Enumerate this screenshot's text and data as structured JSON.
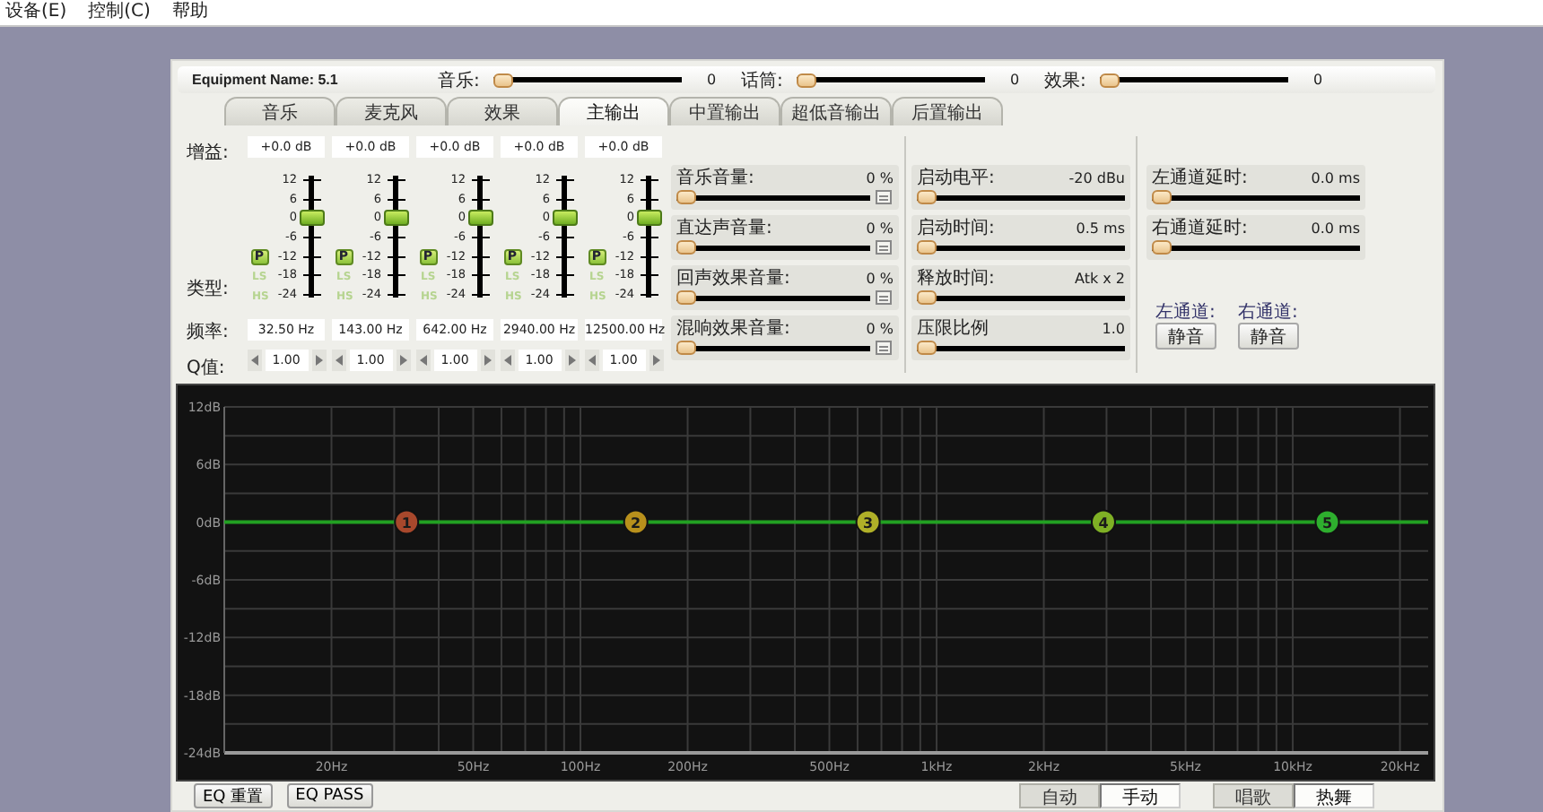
{
  "menu": [
    {
      "label": "设备(E)"
    },
    {
      "label": "控制(C)"
    },
    {
      "label": "帮助"
    }
  ],
  "equipment_name": "Equipment Name: 5.1",
  "top_sliders": [
    {
      "label": "音乐:",
      "level": 0,
      "reading": "0"
    },
    {
      "label": "话筒:",
      "level": 0,
      "reading": "0"
    },
    {
      "label": "效果:",
      "level": 0,
      "reading": "0"
    }
  ],
  "tabs": [
    {
      "label": "音乐",
      "selected": false
    },
    {
      "label": "麦克风",
      "selected": false
    },
    {
      "label": "效果",
      "selected": false
    },
    {
      "label": "主输出",
      "selected": true
    },
    {
      "label": "中置输出",
      "selected": false
    },
    {
      "label": "超低音输出",
      "selected": false
    },
    {
      "label": "后置输出",
      "selected": false
    }
  ],
  "eq_labels": {
    "gain": "增益:",
    "type": "类型:",
    "frequency": "频率:",
    "q": "Q值:"
  },
  "bands": [
    {
      "gain": "+0.0 dB",
      "level": 0.667,
      "scale": [
        "12",
        "6",
        "0",
        "-6",
        "-12",
        "-18",
        "-24"
      ],
      "types": [
        {
          "label": "P",
          "selected": true
        },
        {
          "label": "LS",
          "selected": false
        },
        {
          "label": "HS",
          "selected": false
        }
      ],
      "frequency": "32.50 Hz",
      "q": "1.00"
    },
    {
      "gain": "+0.0 dB",
      "level": 0.667,
      "scale": [
        "12",
        "6",
        "0",
        "-6",
        "-12",
        "-18",
        "-24"
      ],
      "types": [
        {
          "label": "P",
          "selected": true
        },
        {
          "label": "LS",
          "selected": false
        },
        {
          "label": "HS",
          "selected": false
        }
      ],
      "frequency": "143.00 Hz",
      "q": "1.00"
    },
    {
      "gain": "+0.0 dB",
      "level": 0.667,
      "scale": [
        "12",
        "6",
        "0",
        "-6",
        "-12",
        "-18",
        "-24"
      ],
      "types": [
        {
          "label": "P",
          "selected": true
        },
        {
          "label": "LS",
          "selected": false
        },
        {
          "label": "HS",
          "selected": false
        }
      ],
      "frequency": "642.00 Hz",
      "q": "1.00"
    },
    {
      "gain": "+0.0 dB",
      "level": 0.667,
      "scale": [
        "12",
        "6",
        "0",
        "-6",
        "-12",
        "-18",
        "-24"
      ],
      "types": [
        {
          "label": "P",
          "selected": true
        },
        {
          "label": "LS",
          "selected": false
        },
        {
          "label": "HS",
          "selected": false
        }
      ],
      "frequency": "2940.00 Hz",
      "q": "1.00"
    },
    {
      "gain": "+0.0 dB",
      "level": 0.667,
      "scale": [
        "12",
        "6",
        "0",
        "-6",
        "-12",
        "-18",
        "-24"
      ],
      "types": [
        {
          "label": "P",
          "selected": true
        },
        {
          "label": "LS",
          "selected": false
        },
        {
          "label": "HS",
          "selected": false
        }
      ],
      "frequency": "12500.00 Hz",
      "q": "1.00"
    }
  ],
  "mix_sliders": [
    {
      "label": "音乐音量:",
      "reading": "0 %",
      "level": 0
    },
    {
      "label": "直达声音量:",
      "reading": "0 %",
      "level": 0
    },
    {
      "label": "回声效果音量:",
      "reading": "0 %",
      "level": 0
    },
    {
      "label": "混响效果音量:",
      "reading": "0 %",
      "level": 0
    }
  ],
  "dynamics_sliders": [
    {
      "label": "启动电平:",
      "reading": "-20 dBu",
      "level": 0
    },
    {
      "label": "启动时间:",
      "reading": "0.5 ms",
      "level": 0
    },
    {
      "label": "释放时间:",
      "reading": "Atk x 2",
      "level": 0
    },
    {
      "label": "压限比例",
      "reading": "1.0",
      "level": 0
    }
  ],
  "delay_sliders": [
    {
      "label": "左通道延时:",
      "reading": "0.0 ms",
      "level": 0
    },
    {
      "label": "右通道延时:",
      "reading": "0.0 ms",
      "level": 0
    }
  ],
  "mute": [
    {
      "label": "左通道:",
      "button": "静音"
    },
    {
      "label": "右通道:",
      "button": "静音"
    }
  ],
  "chart": {
    "y_axis_labels": [
      "12dB",
      "6dB",
      "0dB",
      "-6dB",
      "-12dB",
      "-18dB",
      "-24dB"
    ],
    "x_axis_labels": [
      "20Hz",
      "50Hz",
      "100Hz",
      "200Hz",
      "500Hz",
      "1kHz",
      "2kHz",
      "5kHz",
      "10kHz",
      "20kHz"
    ],
    "nodes": [
      {
        "label": "1",
        "color": "#a8482c"
      },
      {
        "label": "2",
        "color": "#b8901c"
      },
      {
        "label": "3",
        "color": "#b0b028"
      },
      {
        "label": "4",
        "color": "#7fb025"
      },
      {
        "label": "5",
        "color": "#2eae2e"
      }
    ]
  },
  "eq_buttons": [
    "EQ 重置",
    "EQ PASS"
  ],
  "mode_tabs": [
    {
      "label": "自动",
      "selected": false
    },
    {
      "label": "手动",
      "selected": true
    }
  ],
  "style_tabs": [
    {
      "label": "唱歌",
      "selected": false
    },
    {
      "label": "热舞",
      "selected": true
    }
  ]
}
